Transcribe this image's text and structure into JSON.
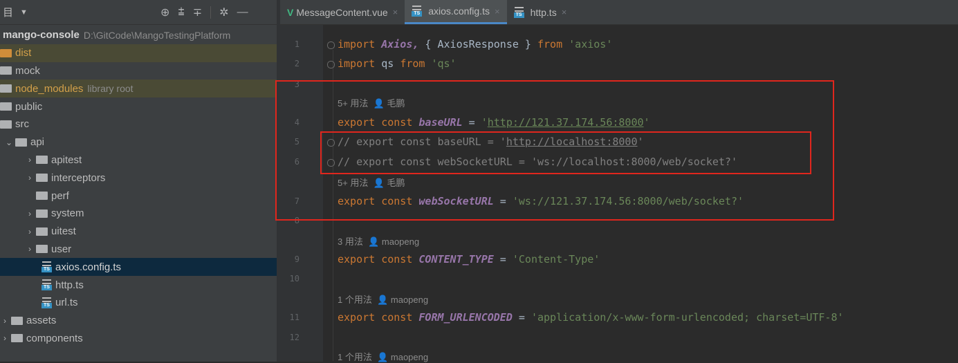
{
  "sidebar": {
    "header_title": "目",
    "tree": [
      {
        "name": "mango-console",
        "hint": "D:\\GitCode\\MangoTestingPlatform",
        "type": "root"
      },
      {
        "name": "dist",
        "type": "folder-excluded"
      },
      {
        "name": "mock",
        "type": "folder"
      },
      {
        "name": "node_modules",
        "hint": "library root",
        "type": "folder-library"
      },
      {
        "name": "public",
        "type": "folder"
      },
      {
        "name": "src",
        "type": "folder"
      },
      {
        "name": "api",
        "type": "folder-open"
      },
      {
        "name": "apitest",
        "type": "folder-sub"
      },
      {
        "name": "interceptors",
        "type": "folder-sub"
      },
      {
        "name": "perf",
        "type": "folder-sub-nochev"
      },
      {
        "name": "system",
        "type": "folder-sub"
      },
      {
        "name": "uitest",
        "type": "folder-sub"
      },
      {
        "name": "user",
        "type": "folder-sub"
      },
      {
        "name": "axios.config.ts",
        "type": "file-selected"
      },
      {
        "name": "http.ts",
        "type": "file"
      },
      {
        "name": "url.ts",
        "type": "file"
      },
      {
        "name": "assets",
        "type": "folder-top"
      },
      {
        "name": "components",
        "type": "folder-top"
      }
    ]
  },
  "tabs": [
    {
      "label": "MessageContent.vue",
      "icon": "vue",
      "active": false
    },
    {
      "label": "axios.config.ts",
      "icon": "ts",
      "active": true
    },
    {
      "label": "http.ts",
      "icon": "ts",
      "active": false
    }
  ],
  "hints": {
    "h1_count": "5+ 用法",
    "h1_user": "毛鹏",
    "h2_count": "5+ 用法",
    "h2_user": "毛鹏",
    "h3_count": "3 用法",
    "h3_user": "maopeng",
    "h4_count": "1 个用法",
    "h4_user": "maopeng",
    "h5_count": "1 个用法",
    "h5_user": "maopeng"
  },
  "code": {
    "l1_kw": "import",
    "l1_axios": "Axios,",
    "l1_mid": " { AxiosResponse } ",
    "l1_from": "from",
    "l1_str": "'axios'",
    "l2_kw": "import",
    "l2_mid": " qs ",
    "l2_from": "from",
    "l2_str": "'qs'",
    "export": "export",
    "const": "const",
    "eq": " = ",
    "l4_name": "baseURL",
    "l4_q1": "'",
    "l4_url": "http://121.37.174.56:8000",
    "l4_q2": "'",
    "l5_cmt": "// export const baseURL = '",
    "l5_url": "http://localhost:8000",
    "l5_end": "'",
    "l6_cmt": "// export const webSocketURL = 'ws://localhost:8000/web/socket?'",
    "l7_name": "webSocketURL",
    "l7_str": "'ws://121.37.174.56:8000/web/socket?'",
    "l9_name": "CONTENT_TYPE",
    "l9_str": "'Content-Type'",
    "l11_name": "FORM_URLENCODED",
    "l11_str": "'application/x-www-form-urlencoded; charset=UTF-8'"
  },
  "line_numbers": [
    "1",
    "2",
    "3",
    "4",
    "5",
    "6",
    "7",
    "8",
    "9",
    "10",
    "11",
    "12"
  ]
}
